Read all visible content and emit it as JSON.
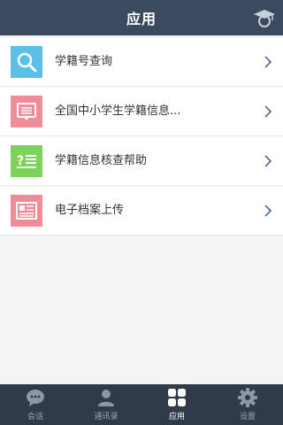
{
  "header": {
    "title": "应用"
  },
  "items": [
    {
      "label": "学籍号查询",
      "icon": "search-icon",
      "color": "#5bc0e8"
    },
    {
      "label": "全国中小学生学籍信息...",
      "icon": "document-icon",
      "color": "#f08c98"
    },
    {
      "label": "学籍信息核查帮助",
      "icon": "help-list-icon",
      "color": "#7dd25a"
    },
    {
      "label": "电子档案上传",
      "icon": "profile-card-icon",
      "color": "#f08c98"
    }
  ],
  "tabs": [
    {
      "label": "会话",
      "icon": "chat-icon"
    },
    {
      "label": "通讯录",
      "icon": "contacts-icon"
    },
    {
      "label": "应用",
      "icon": "apps-grid-icon",
      "active": true
    },
    {
      "label": "设置",
      "icon": "gear-icon"
    }
  ],
  "colors": {
    "header_bg": "#3b4a5c",
    "tabbar_bg": "#2f3b4a",
    "chevron": "#3b5b84"
  }
}
